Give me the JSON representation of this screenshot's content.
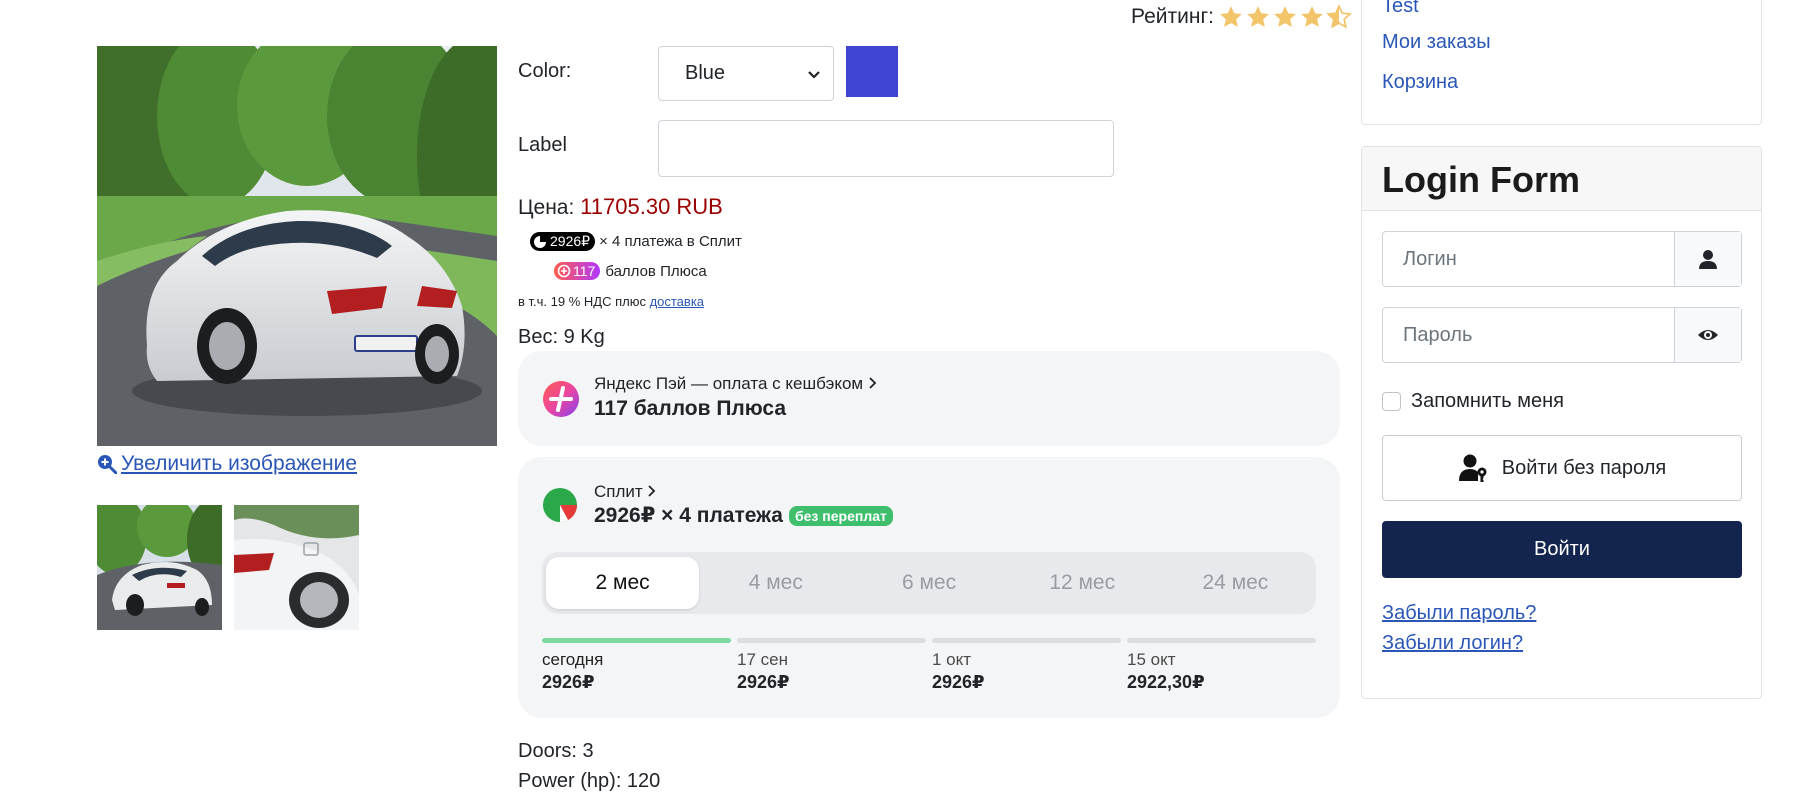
{
  "gallery": {
    "zoom_label": " Увеличить изображение"
  },
  "rating": {
    "label": "Рейтинг:",
    "value": 4.5,
    "max": 5
  },
  "options": {
    "color_label": "Color:",
    "color_selected": "Blue",
    "swatch_color": "#4146d2",
    "label_label": "Label",
    "label_value": ""
  },
  "price": {
    "label": "Цена:",
    "value": "11705.30 RUB"
  },
  "split_promo": {
    "amount": "2926₽",
    "text": "× 4 платежа в Сплит"
  },
  "plus_promo": {
    "points": "117",
    "text": "баллов Плюса"
  },
  "vat": {
    "text": "в т.ч. 19 % НДС  плюс ",
    "delivery_link": "доставка"
  },
  "weight": "Вес: 9 Kg",
  "yandex_pay": {
    "subtitle": "Яндекс Пэй — оплата с кешбэком",
    "title": "117 баллов Плюса"
  },
  "split_card": {
    "subtitle": "Сплит",
    "title": "2926₽ × 4 платежа",
    "badge": "без переплат",
    "tabs": [
      "2 мес",
      "4 мес",
      "6 мес",
      "12 мес",
      "24 мес"
    ],
    "active_tab": 0,
    "schedule": [
      {
        "date": "сегодня",
        "amount": "2926₽",
        "paid": true
      },
      {
        "date": "17 сен",
        "amount": "2926₽",
        "paid": false
      },
      {
        "date": "1 окт",
        "amount": "2926₽",
        "paid": false
      },
      {
        "date": "15 окт",
        "amount": "2922,30₽",
        "paid": false
      }
    ]
  },
  "specs": {
    "doors": "Doors: 3",
    "power": "Power (hp): 120"
  },
  "sidebar_menu": {
    "items": [
      "Test",
      "Мои заказы",
      "Корзина"
    ]
  },
  "login": {
    "title": "Login Form",
    "username_placeholder": "Логин",
    "password_placeholder": "Пароль",
    "remember_label": "Запомнить меня",
    "passwordless_label": "Войти без пароля",
    "submit_label": "Войти",
    "forgot_password": "Забыли пароль?",
    "forgot_login": "Забыли логин?"
  },
  "colors": {
    "link": "#2a57b7",
    "price": "#9b0000",
    "primary_button": "#13244e",
    "star": "#f2c56b",
    "split_paid": "#7ed9a2",
    "badge_green": "#3fbf6e"
  },
  "icons": [
    "zoom-in-icon",
    "star-icon",
    "split-icon",
    "yandex-plus-icon",
    "user-icon",
    "eye-icon",
    "user-key-icon",
    "chevron-right-icon",
    "chevron-down-icon"
  ]
}
